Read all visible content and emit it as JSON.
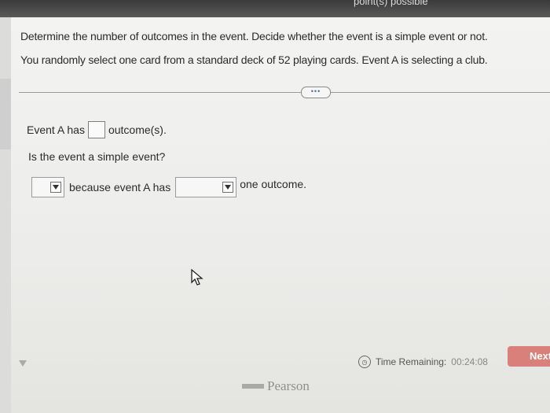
{
  "header": {
    "points_text": "point(s) possible"
  },
  "question": {
    "instruction": "Determine the number of outcomes in the event. Decide whether the event is a simple event or not.",
    "problem": "You randomly select one card from a standard deck of 52 playing cards. Event A is selecting a club."
  },
  "more_button_label": "•••",
  "answer": {
    "row1_prefix": "Event A has",
    "row1_suffix": "outcome(s).",
    "row2_text": "Is the event a simple event?",
    "row3_middle": "because event A has",
    "row3_suffix": "one outcome."
  },
  "footer": {
    "time_label": "Time Remaining:",
    "time_value": "00:24:08",
    "clock_glyph": "◷",
    "next_label": "Next",
    "brand": "Pearson"
  },
  "icons": [
    "arrow-cursor-icon",
    "clock-icon",
    "dropdown-arrow-icon",
    "side-triangle-icon"
  ]
}
